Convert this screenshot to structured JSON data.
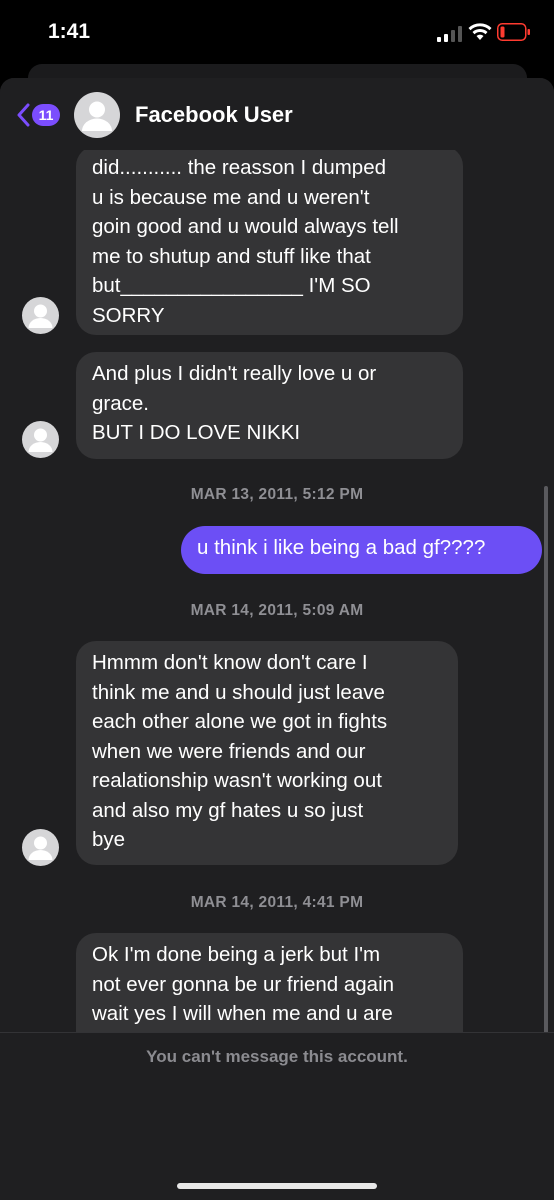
{
  "status": {
    "time": "1:41"
  },
  "header": {
    "back_badge": "11",
    "contact_name": "Facebook User"
  },
  "messages": [
    {
      "type": "received",
      "text": "did........... the reasson I dumped\nu is because me and u weren't\ngoin good and u would always tell\nme to shutup and stuff like that\nbut________________ I'M SO\nSORRY"
    },
    {
      "type": "received",
      "text": "And plus I didn't really love u or\ngrace.\nBUT I DO LOVE NIKKI"
    },
    {
      "type": "timestamp",
      "text": "MAR 13, 2011, 5:12 PM"
    },
    {
      "type": "sent",
      "text": "u think i like being a bad gf????"
    },
    {
      "type": "timestamp",
      "text": "MAR 14, 2011, 5:09 AM"
    },
    {
      "type": "received",
      "text": "Hmmm don't know don't care I\nthink me and u should just leave\neach other alone we got in fights\nwhen we were friends and our\nrealationship wasn't working out\nand also my gf hates u so just\nbye"
    },
    {
      "type": "timestamp",
      "text": "MAR 14, 2011, 4:41 PM"
    },
    {
      "type": "received",
      "text": "Ok I'm done being a jerk but I'm\nnot ever gonna be ur friend again\nwait yes I will when me and u are\ngood"
    }
  ],
  "footer": {
    "notice": "You can't message this account."
  },
  "colors": {
    "accent": "#7b4dfd",
    "sent_bubble": "#6c4ff5",
    "received_bubble": "#343436",
    "battery_low": "#ff3b30"
  }
}
